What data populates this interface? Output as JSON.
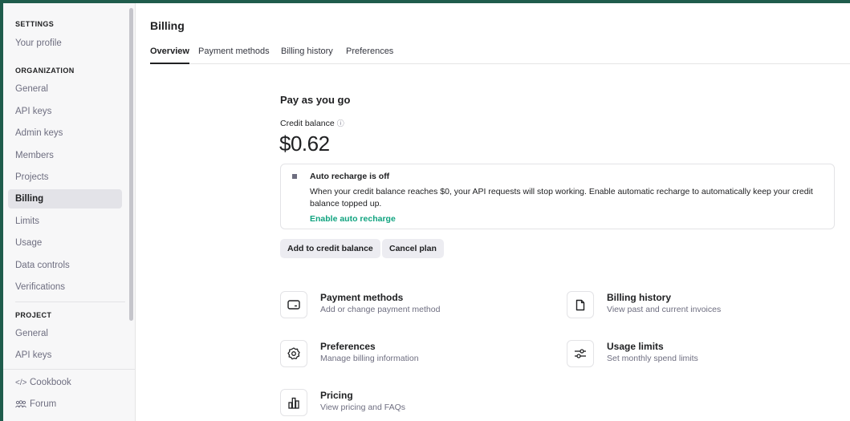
{
  "sidebar": {
    "settings_header": "SETTINGS",
    "your_profile": "Your profile",
    "organization_header": "ORGANIZATION",
    "org_items": [
      "General",
      "API keys",
      "Admin keys",
      "Members",
      "Projects",
      "Billing",
      "Limits",
      "Usage",
      "Data controls",
      "Verifications"
    ],
    "project_header": "PROJECT",
    "project_items": [
      "General",
      "API keys"
    ],
    "cookbook": "Cookbook",
    "forum": "Forum",
    "cookbook_icon": "</>",
    "forum_icon": "people-icon"
  },
  "main": {
    "title": "Billing",
    "tabs": [
      "Overview",
      "Payment methods",
      "Billing history",
      "Preferences"
    ],
    "active_tab": "Overview",
    "plan_title": "Pay as you go",
    "credit_label": "Credit balance",
    "balance": "$0.62",
    "notice": {
      "title": "Auto recharge is off",
      "body": "When your credit balance reaches $0, your API requests will stop working. Enable automatic recharge to automatically keep your credit balance topped up.",
      "link": "Enable auto recharge"
    },
    "buttons": {
      "add_credit": "Add to credit balance",
      "cancel_plan": "Cancel plan"
    },
    "cards": [
      {
        "title": "Payment methods",
        "desc": "Add or change payment method",
        "icon": "credit-card-icon"
      },
      {
        "title": "Billing history",
        "desc": "View past and current invoices",
        "icon": "document-icon"
      },
      {
        "title": "Preferences",
        "desc": "Manage billing information",
        "icon": "gear-icon"
      },
      {
        "title": "Usage limits",
        "desc": "Set monthly spend limits",
        "icon": "sliders-icon"
      },
      {
        "title": "Pricing",
        "desc": "View pricing and FAQs",
        "icon": "bar-chart-icon"
      }
    ]
  },
  "colors": {
    "accent_green": "#10a37f",
    "frame_bg": "#1f5c4c",
    "sidebar_bg": "#f7f7f8",
    "active_item_bg": "#e3e3e8"
  }
}
